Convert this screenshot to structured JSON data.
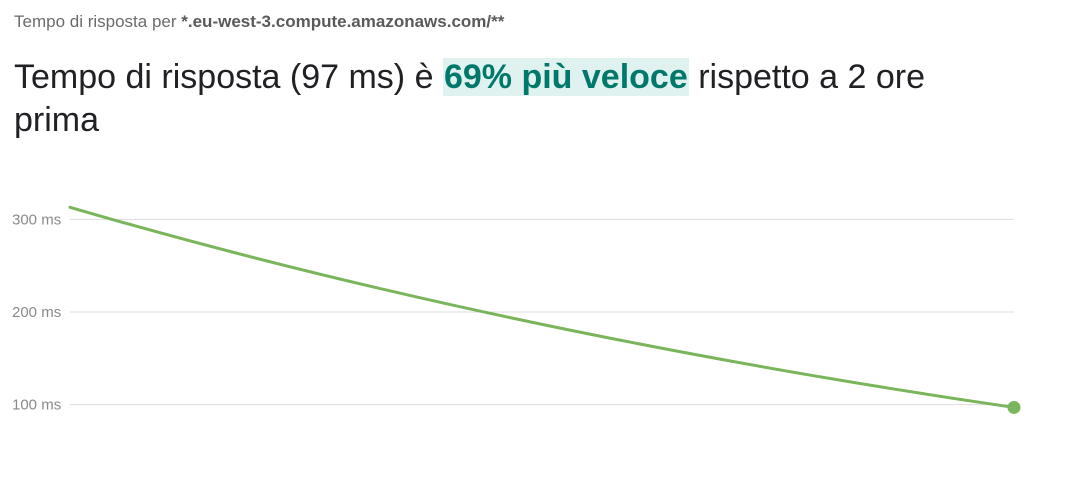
{
  "header": {
    "subtitle_prefix": "Tempo di risposta per",
    "subtitle_host": "*.eu-west-3.compute.amazonaws.com/**",
    "headline_before": "Tempo di risposta (97 ms) è",
    "headline_highlight": "69% più veloce",
    "headline_after": "rispetto a 2 ore prima"
  },
  "colors": {
    "line": "#7ab55c",
    "highlight_text": "#00796b",
    "highlight_bg": "#e0f2ef",
    "grid": "#dedede"
  },
  "chart_data": {
    "type": "line",
    "x": [
      0,
      1
    ],
    "series": [
      {
        "values": [
          313,
          97
        ]
      }
    ],
    "ylim": [
      50,
      350
    ],
    "yticks": [
      300,
      200,
      100
    ],
    "ytick_labels": [
      "300 ms",
      "200 ms",
      "100 ms"
    ],
    "grid": true,
    "end_marker": true
  }
}
